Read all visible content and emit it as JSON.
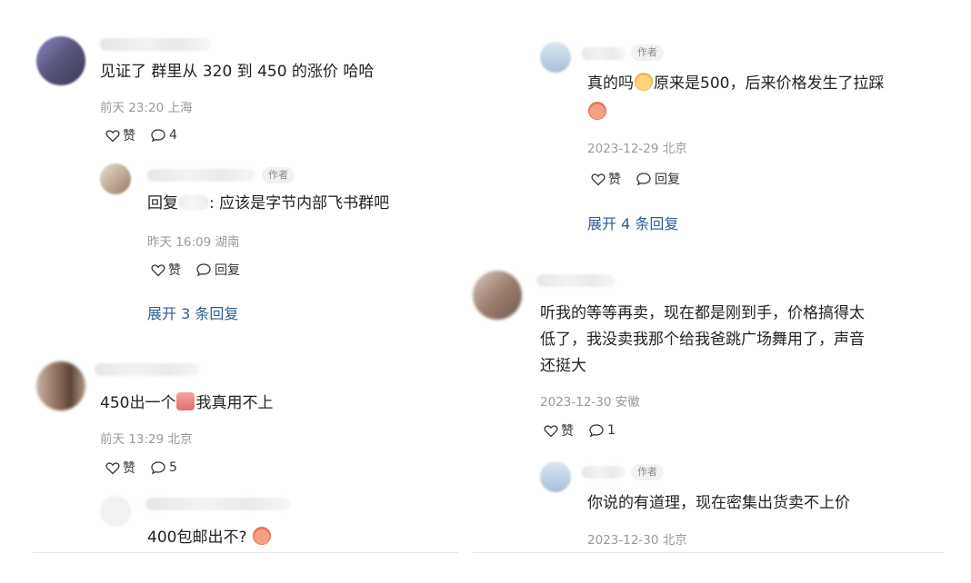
{
  "left": {
    "c1": {
      "text": "见证了 群里从 320 到 450 的涨价 哈哈",
      "meta": "前天 23:20 上海",
      "like": "赞",
      "reply_count": "4"
    },
    "c1r1": {
      "tag": "作者",
      "reply_prefix": "回复",
      "reply_rest": ": 应该是字节内部飞书群吧",
      "meta": "昨天 16:09 湖南",
      "like": "赞",
      "reply": "回复"
    },
    "c1_expand": "展开 3 条回复",
    "c2": {
      "text_a": "450出一个",
      "text_b": "我真用不上",
      "meta": "前天 13:29 北京",
      "like": "赞",
      "reply_count": "5"
    },
    "c2r1": {
      "text": "400包邮出不?"
    }
  },
  "right": {
    "r1": {
      "tag": "作者",
      "line1_a": "真的吗",
      "line1_b": "原来是500，后来价格发生了拉踩",
      "meta": "2023-12-29 北京",
      "like": "赞",
      "reply": "回复"
    },
    "r1_expand": "展开 4 条回复",
    "r2": {
      "line1": "听我的等等再卖，现在都是刚到手，价格搞得太",
      "line2": "低了，我没卖我那个给我爸跳广场舞用了，声音",
      "line3": "还挺大",
      "meta": "2023-12-30 安徽",
      "like": "赞",
      "reply_count": "1"
    },
    "r2r1": {
      "tag": "作者",
      "text": "你说的有道理，现在密集出货卖不上价",
      "meta": "2023-12-30 北京"
    }
  }
}
